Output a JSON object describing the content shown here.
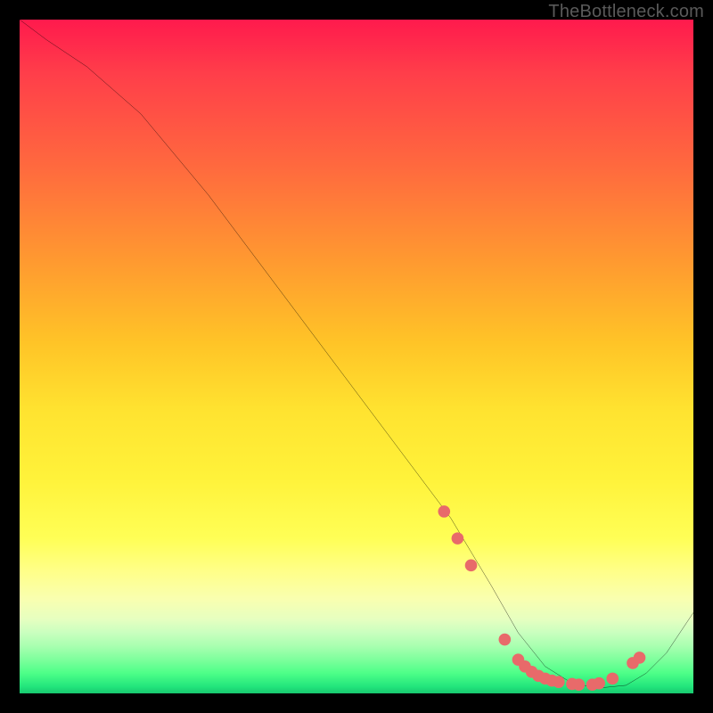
{
  "watermark": "TheBottleneck.com",
  "chart_data": {
    "type": "line",
    "title": "",
    "xlabel": "",
    "ylabel": "",
    "xlim": [
      0,
      100
    ],
    "ylim": [
      0,
      100
    ],
    "grid": false,
    "series": [
      {
        "name": "curve",
        "x": [
          0,
          4,
          10,
          18,
          28,
          40,
          52,
          64,
          70,
          74,
          78,
          82,
          86,
          90,
          93,
          96,
          100
        ],
        "y": [
          100,
          97,
          93,
          86,
          74,
          58,
          42,
          26,
          16,
          9,
          4,
          1.5,
          0.8,
          1.2,
          3,
          6,
          12
        ]
      }
    ],
    "markers": {
      "name": "dots",
      "x": [
        63,
        65,
        67,
        72,
        74,
        75,
        76,
        77,
        78,
        79,
        80,
        82,
        83,
        85,
        86,
        88,
        91,
        92
      ],
      "y": [
        27,
        23,
        19,
        8,
        5,
        4,
        3.2,
        2.6,
        2.2,
        1.9,
        1.7,
        1.4,
        1.3,
        1.3,
        1.5,
        2.2,
        4.5,
        5.3
      ]
    },
    "colors": {
      "curve_stroke": "#000000",
      "marker_fill": "#e86a6a",
      "gradient_top": "#ff1a4d",
      "gradient_bottom": "#18c86f"
    }
  }
}
